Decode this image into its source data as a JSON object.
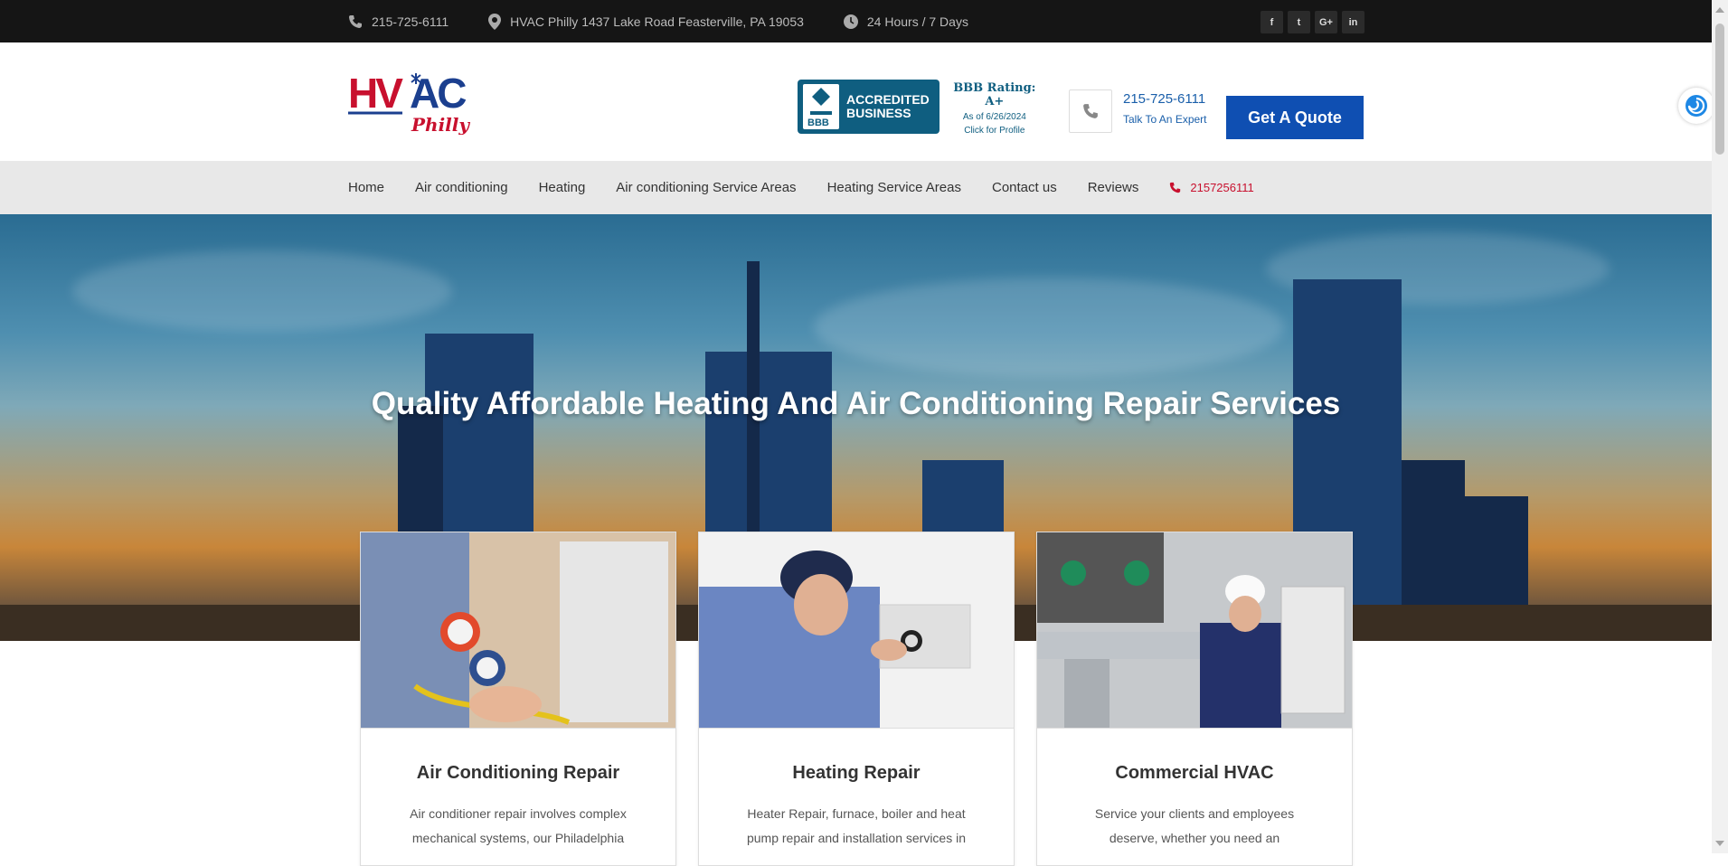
{
  "topbar": {
    "phone": "215-725-6111",
    "address": "HVAC Philly 1437 Lake Road Feasterville, PA 19053",
    "hours": "24 Hours / 7 Days",
    "social": [
      "f",
      "t",
      "G+",
      "in"
    ]
  },
  "header": {
    "logo_main": "HVAC",
    "logo_sub": "Philly",
    "bbb": {
      "badge_line1": "ACCREDITED",
      "badge_line2": "BUSINESS",
      "rating": "BBB Rating: A+",
      "as_of": "As of 6/26/2024",
      "profile": "Click for Profile"
    },
    "call_number": "215-725-6111",
    "call_sub": "Talk To An Expert",
    "quote_button": "Get A Quote"
  },
  "nav": {
    "items": [
      "Home",
      "Air conditioning",
      "Heating",
      "Air conditioning Service Areas",
      "Heating Service Areas",
      "Contact us",
      "Reviews"
    ],
    "phone": "2157256111"
  },
  "hero": {
    "title": "Quality Affordable Heating And Air Conditioning Repair Services"
  },
  "cards": [
    {
      "title": "Air Conditioning Repair",
      "text": "Air conditioner repair involves complex mechanical systems, our Philadelphia"
    },
    {
      "title": "Heating Repair",
      "text": "Heater Repair, furnace, boiler and heat pump repair and installation services in"
    },
    {
      "title": "Commercial HVAC",
      "text": "Service your clients and employees deserve, whether you need an"
    }
  ],
  "colors": {
    "topbar_bg": "#151515",
    "nav_bg": "#e8e8e8",
    "accent_blue": "#0f4fb2",
    "accent_red": "#c8102e"
  }
}
